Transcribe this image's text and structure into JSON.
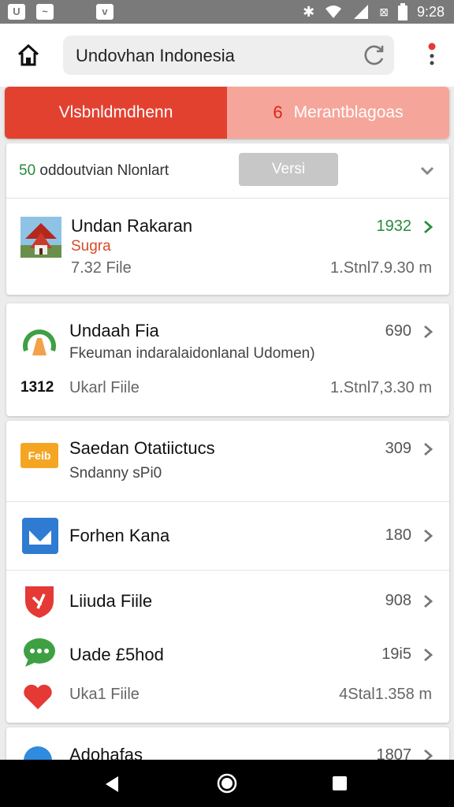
{
  "status_bar": {
    "time": "9:28"
  },
  "app_bar": {
    "search_text": "Undovhan Indonesia"
  },
  "tabs": [
    {
      "label": "Vlsbnldmdhenn"
    },
    {
      "count": "6",
      "label": "Merantblagoas"
    }
  ],
  "filter": {
    "count": "50",
    "label": "oddoutvian Nlonlart",
    "button": "Versi"
  },
  "items": [
    {
      "title": "Undan Rakaran",
      "subtitle": "Sugra",
      "meta": "7.32 File",
      "number": "1932",
      "size": "1.Stnl7.9.30 m"
    },
    {
      "title": "Undaah Fia",
      "subtitle": "Fkeuman indaralaidonlanal Udomen)",
      "badge": "1312",
      "meta": "Ukarl Fiile",
      "number": "690",
      "size": "1.Stnl7,3.30 m"
    },
    {
      "title": "Saedan Otatiictucs",
      "subtitle": "Sndanny sPi0",
      "icon_label": "Feib",
      "number": "309"
    },
    {
      "title": "Forhen Kana",
      "number": "180"
    },
    {
      "title": "Liiuda Fiile",
      "number": "908"
    },
    {
      "title": "Uade £5hod",
      "number": "19i5"
    },
    {
      "title": "",
      "meta": "Uka1 Fiile",
      "size": "4Stal1.358 m"
    },
    {
      "title": "Adohafas",
      "number": "1807"
    }
  ],
  "colors": {
    "accent_red": "#e34130",
    "accent_pink": "#f6a59a",
    "green_number": "#2a8a3a"
  }
}
